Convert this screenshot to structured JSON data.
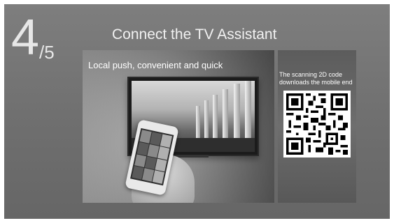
{
  "step": {
    "current": "4",
    "total": "/5"
  },
  "title": "Connect the TV Assistant",
  "promo": {
    "caption": "Local push, convenient and quick"
  },
  "qr": {
    "caption_line1": "The scanning 2D code",
    "caption_line2": "downloads the mobile end"
  },
  "colors": {
    "background": "#747474",
    "text": "#ffffff"
  }
}
